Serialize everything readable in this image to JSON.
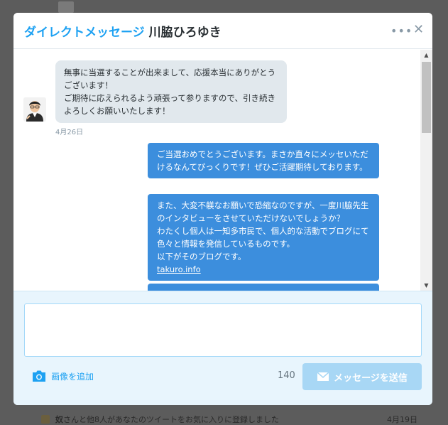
{
  "background": {
    "notification": {
      "name": "奴",
      "text": "さんと他8人があなたのツイートをお気に入りに登録しました",
      "date": "4月19日"
    }
  },
  "modal": {
    "title_prefix": "ダイレクトメッセージ",
    "title_name": "川脇ひろゆき",
    "more_icon": "•••",
    "close_icon": "✕"
  },
  "conversation": {
    "incoming": {
      "text": "無事に当選することが出来まして、応援本当にありがとうございます！\nご期待に応えられるよう頑張って参りますので、引き続きよろしくお願いいたします！",
      "date": "4月26日"
    },
    "outgoing": [
      {
        "text": "ご当選おめでとうございます。まさか直々にメッセいただけるなんてびっくりです！ぜひご活躍期待しております。"
      },
      {
        "text": "また、大変不躾なお願いで恐縮なのですが、一度川脇先生のインタビューをさせていただけないでしょうか？\nわたくし個人は一知多市民で、個人的な活動でブログにて色々と情報を発信しているものです。\n以下がそのブログです。",
        "link": "takuro.info"
      }
    ]
  },
  "composer": {
    "placeholder": "",
    "add_image_label": "画像を追加",
    "char_count": "140",
    "send_label": "メッセージを送信"
  },
  "colors": {
    "accent": "#1da1f2",
    "outgoing_bubble": "#3c8edd",
    "incoming_bubble": "#e1e8ed",
    "send_button_disabled": "#a8d7f5"
  },
  "icons": {
    "camera": "camera-icon",
    "send": "envelope-icon",
    "more": "more-icon",
    "close": "close-icon"
  }
}
